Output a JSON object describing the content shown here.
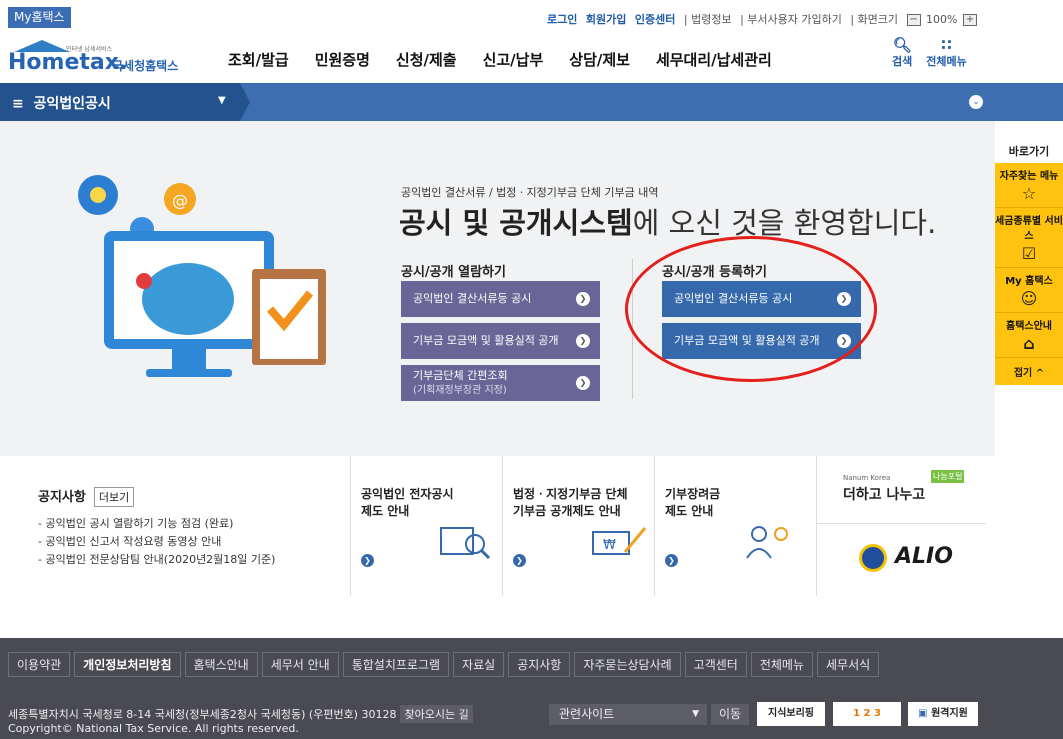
{
  "top": {
    "badge": "My홈택스",
    "links": [
      "로그인",
      "회원가입",
      "인증센터",
      "| 법령정보",
      "| 부서사용자 가입하기",
      "| 화면크기"
    ],
    "zoom": "100%",
    "zoom_minus": "−",
    "zoom_plus": "+"
  },
  "header": {
    "logo_sub": "인터넷 납세서비스",
    "logo_main": "Hometax.",
    "logo_ko": "국세청홈택스",
    "nav": [
      "조회/발급",
      "민원증명",
      "신청/제출",
      "신고/납부",
      "상담/제보",
      "세무대리/납세관리"
    ],
    "search_label": "검색",
    "menu_label": "전체메뉴"
  },
  "bluebar": {
    "title": "공익법인공시"
  },
  "hero": {
    "subtitle": "공익법인 결산서류 / 법정ㆍ지정기부금 단체 기부금 내역",
    "title_bold": "공시 및 공개시스템",
    "title_rest": "에 오신 것을 환영합니다.",
    "col1_heading": "공시/공개 열람하기",
    "col2_heading": "공시/공개 등록하기",
    "col1_buttons": [
      "공익법인 결산서류등 공시",
      "기부금 모금액 및 활용실적 공개"
    ],
    "col1_btn3_main": "기부금단체 간편조회",
    "col1_btn3_sub": "(기획재정부장관 지정)",
    "col2_buttons": [
      "공익법인 결산서류등 공시",
      "기부금 모금액 및 활용실적 공개"
    ]
  },
  "quick": {
    "title": "바로가기",
    "items": [
      {
        "label": "자주찾는 메뉴",
        "icon": "star-icon"
      },
      {
        "label": "세금종류별 서비스",
        "icon": "checkbox-icon"
      },
      {
        "label": "My 홈택스",
        "icon": "person-icon"
      },
      {
        "label": "홈택스안내",
        "icon": "home-icon"
      }
    ],
    "fold": "접기 ^"
  },
  "notice": {
    "title": "공지사항",
    "more": "더보기",
    "items": [
      "공익법인 공시 열람하기 기능 점검 (완료)",
      "공익법인 신고서 작성요령 동영상 안내",
      "공익법인 전문상담팀 안내(2020년2월18일 기준)"
    ]
  },
  "cells": [
    "공익법인 전자공시\n제도 안내",
    "법정ㆍ지정기부금 단체\n기부금 공개제도 안내",
    "기부장려금\n제도 안내"
  ],
  "banners": {
    "nanum_top": "Nanum Korea",
    "nanum": "더하고 나누고",
    "nanum_tag": "나눔포털",
    "alio": "ALIO"
  },
  "footer": {
    "nav": [
      "이용약관",
      "개인정보처리방침",
      "홈택스안내",
      "세무서 안내",
      "통합설치프로그램",
      "자료실",
      "공지사항",
      "자주묻는상담사례",
      "고객센터",
      "전체메뉴",
      "세무서식"
    ],
    "address": "세종특별자치시 국세청로 8-14 국세청(정부세종2청사 국세청동) (우편번호) 30128",
    "findway": "찾아오시는 길",
    "copyright": "Copyright© National Tax Service. All rights reserved.",
    "related": "관련사이트",
    "move": "이동",
    "banner1": "지식보리핑",
    "banner2": "1 2 3",
    "banner3": "원격지원"
  }
}
